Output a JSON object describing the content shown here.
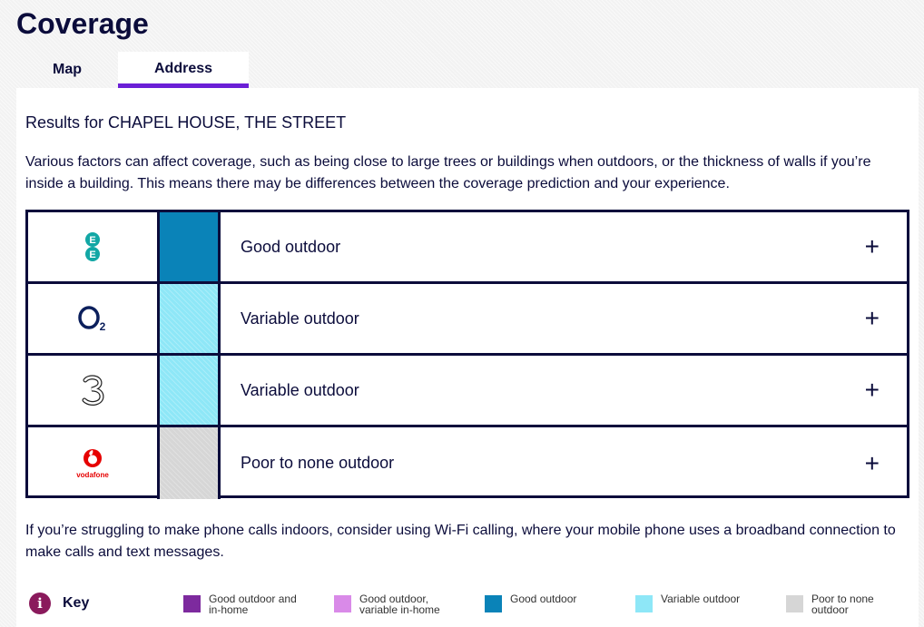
{
  "page": {
    "title": "Coverage"
  },
  "tabs": [
    {
      "label": "Map",
      "active": false
    },
    {
      "label": "Address",
      "active": true
    }
  ],
  "results": {
    "heading": "Results for CHAPEL HOUSE, THE STREET",
    "intro": "Various factors can affect coverage, such as being close to large trees or buildings when outdoors, or the thickness of walls if you’re inside a building. This means there may be differences between the coverage prediction and your experience."
  },
  "operators": [
    {
      "name": "EE",
      "icon": "ee-logo-icon",
      "coverage": "Good outdoor",
      "color": "#0a83b8"
    },
    {
      "name": "O2",
      "icon": "o2-logo-icon",
      "coverage": "Variable outdoor",
      "color": "#8ee7f7"
    },
    {
      "name": "Three",
      "icon": "three-logo-icon",
      "coverage": "Variable outdoor",
      "color": "#8ee7f7"
    },
    {
      "name": "vodafone",
      "icon": "vodafone-logo-icon",
      "coverage": "Poor to none outdoor",
      "color": "#d6d6d6"
    }
  ],
  "expand_symbol": "+",
  "outro": "If you’re struggling to make phone calls indoors, consider using Wi-Fi calling, where your mobile phone uses a broadband connection to make calls and text messages.",
  "key": {
    "info_symbol": "i",
    "title": "Key",
    "items": [
      {
        "label": "Good outdoor and in-home",
        "color": "#7d2a9e"
      },
      {
        "label": "Good outdoor, variable in-home",
        "color": "#d98ae8"
      },
      {
        "label": "Good outdoor",
        "color": "#0a83b8"
      },
      {
        "label": "Variable outdoor",
        "color": "#8ee7f7"
      },
      {
        "label": "Poor to none outdoor",
        "color": "#d6d6d6"
      }
    ]
  }
}
